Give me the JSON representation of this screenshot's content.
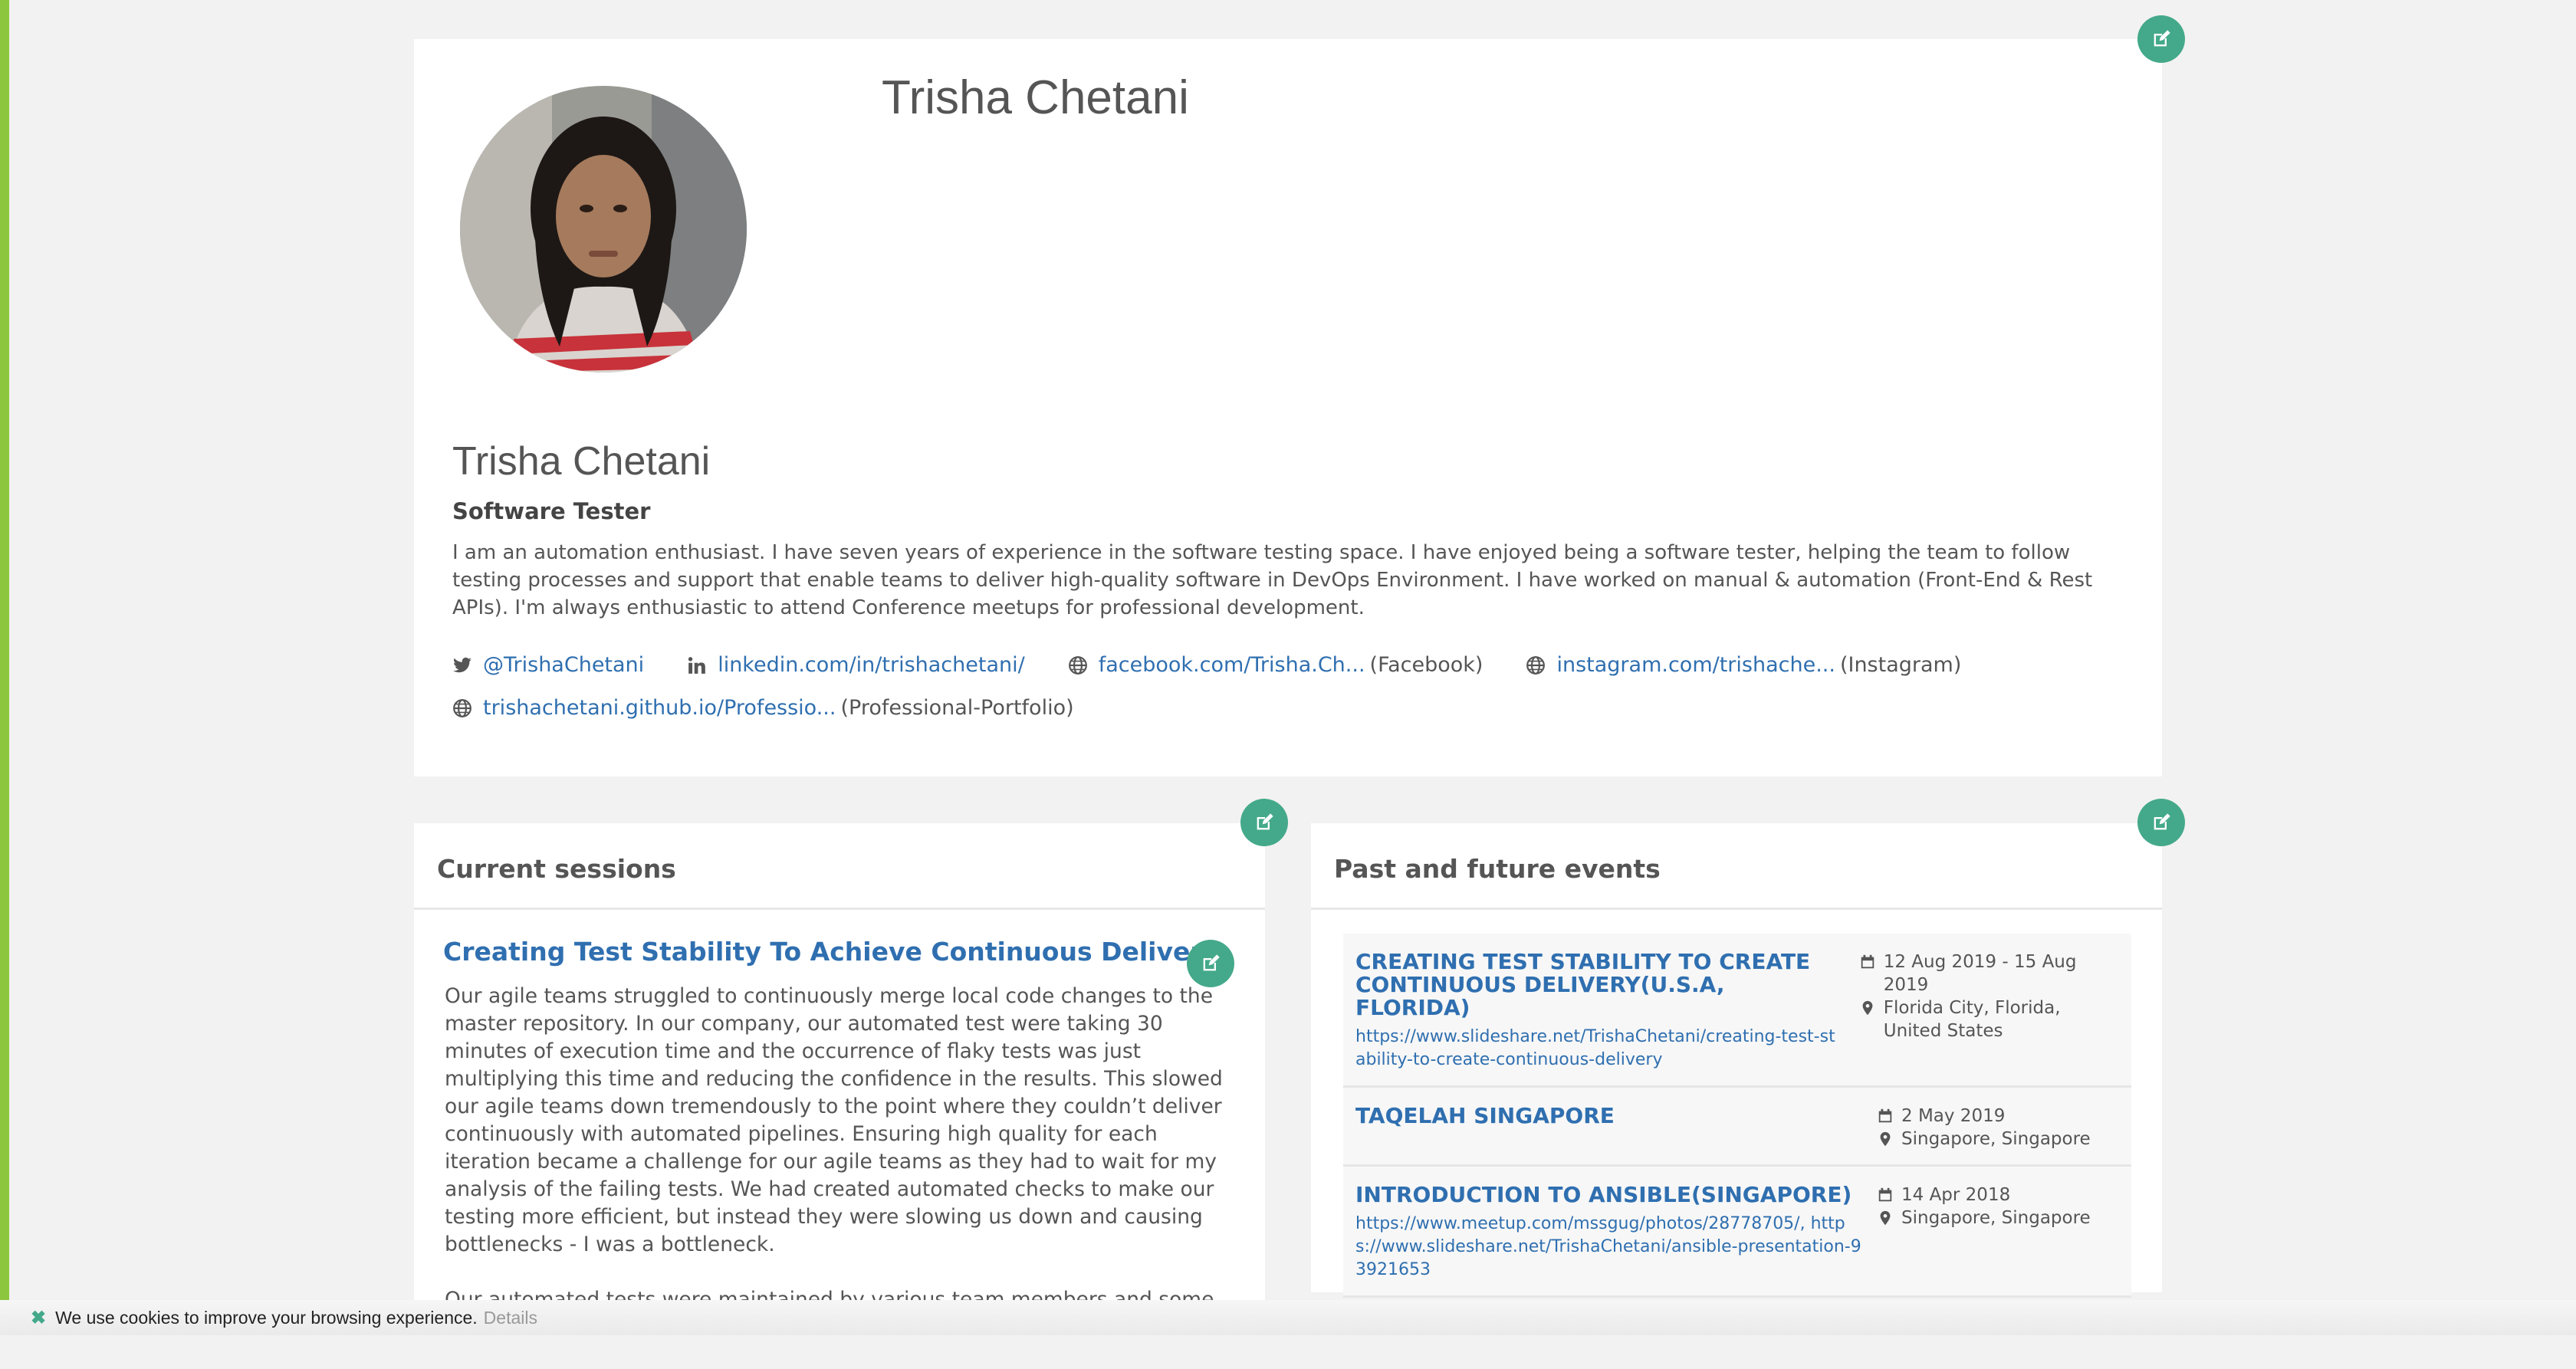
{
  "profile": {
    "header_name": "Trisha Chetani",
    "name": "Trisha Chetani",
    "title": "Software Tester",
    "bio": "I am an automation enthusiast. I have seven years of experience in the software testing space. I have enjoyed being a software tester, helping the team to follow testing processes and support that enable teams to deliver high-quality software in DevOps Environment. I have worked on manual & automation (Front-End & Rest APIs). I'm always enthusiastic to attend Conference meetups for professional development.",
    "socials": [
      {
        "icon": "twitter-icon",
        "text": "@TrishaChetani",
        "suffix": ""
      },
      {
        "icon": "linkedin-icon",
        "text": "linkedin.com/in/trishachetani/",
        "suffix": ""
      },
      {
        "icon": "globe-icon",
        "text": "facebook.com/Trisha.Ch...",
        "suffix": "(Facebook)"
      },
      {
        "icon": "globe-icon",
        "text": "instagram.com/trishache...",
        "suffix": "(Instagram)"
      },
      {
        "icon": "globe-icon",
        "text": "trishachetani.github.io/Professio...",
        "suffix": "(Professional-Portfolio)"
      }
    ]
  },
  "sessions": {
    "heading": "Current sessions",
    "items": [
      {
        "title": "Creating Test Stability To Achieve Continuous Delivery",
        "paragraphs": [
          "Our agile teams struggled to continuously merge local code changes to the master repository. In our company, our automated test were taking 30 minutes of execution time and the occurrence of flaky tests was just multiplying this time and reducing the confidence in the results. This slowed our agile teams down tremendously to the point where they couldn’t deliver continuously with automated pipelines. Ensuring high quality for each iteration became a challenge for our agile teams as they had to wait for my analysis of the failing tests. We had created automated checks to make our testing more efficient, but instead they were slowing us down and causing bottlenecks - I was a bottleneck.",
          "Our automated tests were maintained by various team members and some of them"
        ]
      }
    ]
  },
  "events": {
    "heading": "Past and future events",
    "items": [
      {
        "title": "CREATING TEST STABILITY TO CREATE CONTINUOUS DELIVERY(U.S.A, FLORIDA)",
        "links": "https://www.slideshare.net/TrishaChetani/creating-test-stability-to-create-continuous-delivery",
        "date": "12 Aug 2019 - 15 Aug 2019",
        "location": "Florida City, Florida, United States"
      },
      {
        "title": "TAQELAH SINGAPORE",
        "links": "",
        "date": "2 May 2019",
        "location": "Singapore, Singapore"
      },
      {
        "title": "INTRODUCTION TO ANSIBLE(SINGAPORE)",
        "links": "https://www.meetup.com/mssgug/photos/28778705/, https://www.slideshare.net/TrishaChetani/ansible-presentation-93921653",
        "date": "14 Apr 2018",
        "location": "Singapore, Singapore"
      }
    ]
  },
  "cookie": {
    "message": "We use cookies to improve your browsing experience.",
    "details": "Details"
  },
  "colors": {
    "accent": "#44a98a",
    "link": "#2f6fb0",
    "left_stripe": "#8cc63f",
    "background": "#f2f2f2"
  }
}
